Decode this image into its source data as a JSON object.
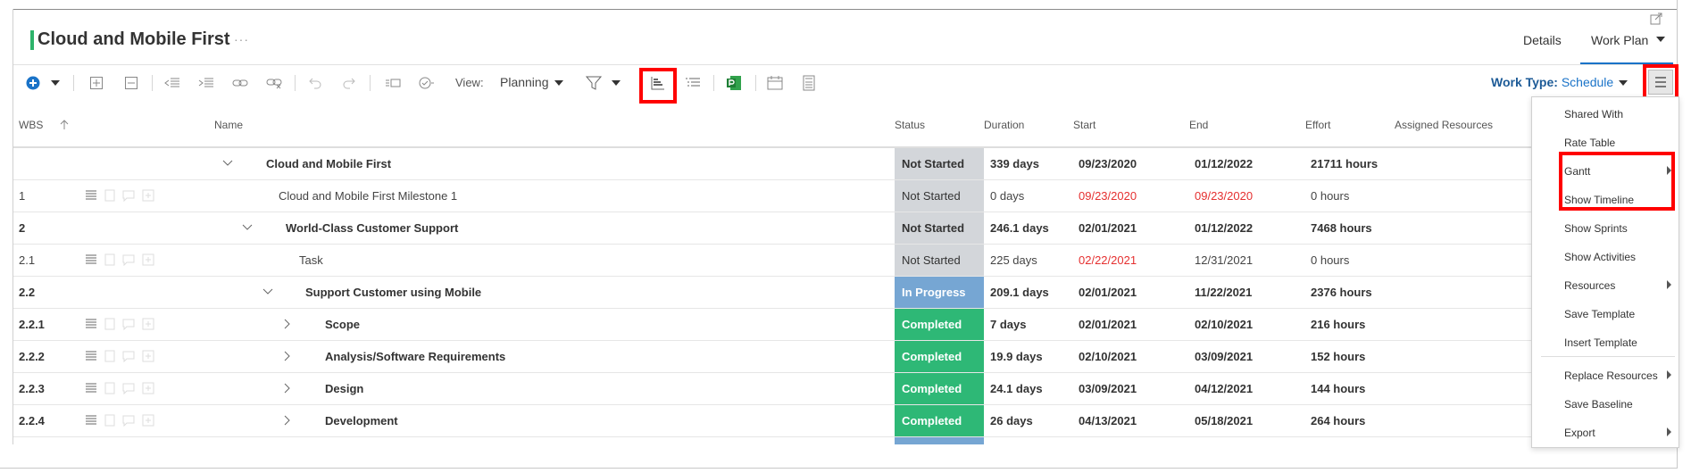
{
  "header": {
    "title": "Cloud and Mobile First",
    "title_more": "···",
    "tabs": [
      "Details",
      "Work Plan"
    ]
  },
  "toolbar": {
    "view_label": "View:",
    "view_value": "Planning",
    "work_type_label": "Work Type:",
    "work_type_value": "Schedule",
    "icons": [
      "add-icon",
      "caret-icon",
      "expand-all-icon",
      "collapse-all-icon",
      "outdent-icon",
      "indent-icon",
      "link-icon",
      "unlink-icon",
      "undo-icon",
      "redo-icon",
      "baseline-icon",
      "check-icon",
      "filter-icon",
      "gantt-icon",
      "list-indent-icon",
      "ms-project-icon",
      "calendar-icon",
      "calculator-icon",
      "menu-icon"
    ]
  },
  "columns": [
    "WBS",
    "Name",
    "Status",
    "Duration",
    "Start",
    "End",
    "Effort",
    "Assigned Resources"
  ],
  "rows": [
    {
      "wbs": "",
      "name": "Cloud and Mobile First",
      "status": "Not Started",
      "duration": "339 days",
      "start": "09/23/2020",
      "end": "01/12/2022",
      "effort": "21711 hours"
    },
    {
      "wbs": "1",
      "name": "Cloud and Mobile First Milestone 1",
      "status": "Not Started",
      "duration": "0 days",
      "start": "09/23/2020",
      "end": "09/23/2020",
      "effort": "0 hours"
    },
    {
      "wbs": "2",
      "name": "World-Class Customer Support",
      "status": "Not Started",
      "duration": "246.1 days",
      "start": "02/01/2021",
      "end": "01/12/2022",
      "effort": "7468 hours"
    },
    {
      "wbs": "2.1",
      "name": "Task",
      "status": "Not Started",
      "duration": "225 days",
      "start": "02/22/2021",
      "end": "12/31/2021",
      "effort": "0 hours"
    },
    {
      "wbs": "2.2",
      "name": "Support Customer using Mobile",
      "status": "In Progress",
      "duration": "209.1 days",
      "start": "02/01/2021",
      "end": "11/22/2021",
      "effort": "2376 hours"
    },
    {
      "wbs": "2.2.1",
      "name": "Scope",
      "status": "Completed",
      "duration": "7 days",
      "start": "02/01/2021",
      "end": "02/10/2021",
      "effort": "216 hours"
    },
    {
      "wbs": "2.2.2",
      "name": "Analysis/Software Requirements",
      "status": "Completed",
      "duration": "19.9 days",
      "start": "02/10/2021",
      "end": "03/09/2021",
      "effort": "152 hours"
    },
    {
      "wbs": "2.2.3",
      "name": "Design",
      "status": "Completed",
      "duration": "24.1 days",
      "start": "03/09/2021",
      "end": "04/12/2021",
      "effort": "144 hours"
    },
    {
      "wbs": "2.2.4",
      "name": "Development",
      "status": "Completed",
      "duration": "26 days",
      "start": "04/13/2021",
      "end": "05/18/2021",
      "effort": "264 hours"
    }
  ],
  "menu": {
    "items": [
      "Shared With",
      "Rate Table",
      "Gantt",
      "Show Timeline",
      "Show Sprints",
      "Show Activities",
      "Resources",
      "Save Template",
      "Insert Template",
      "Replace Resources",
      "Save Baseline",
      "Export"
    ]
  },
  "colors": {
    "accent": "#1a73c8",
    "title_bar": "#2db36b",
    "not_started": "#d3d6da",
    "in_progress": "#76a6d3",
    "completed": "#2eb876",
    "highlight": "#ff0000",
    "late_date": "#e53030"
  }
}
